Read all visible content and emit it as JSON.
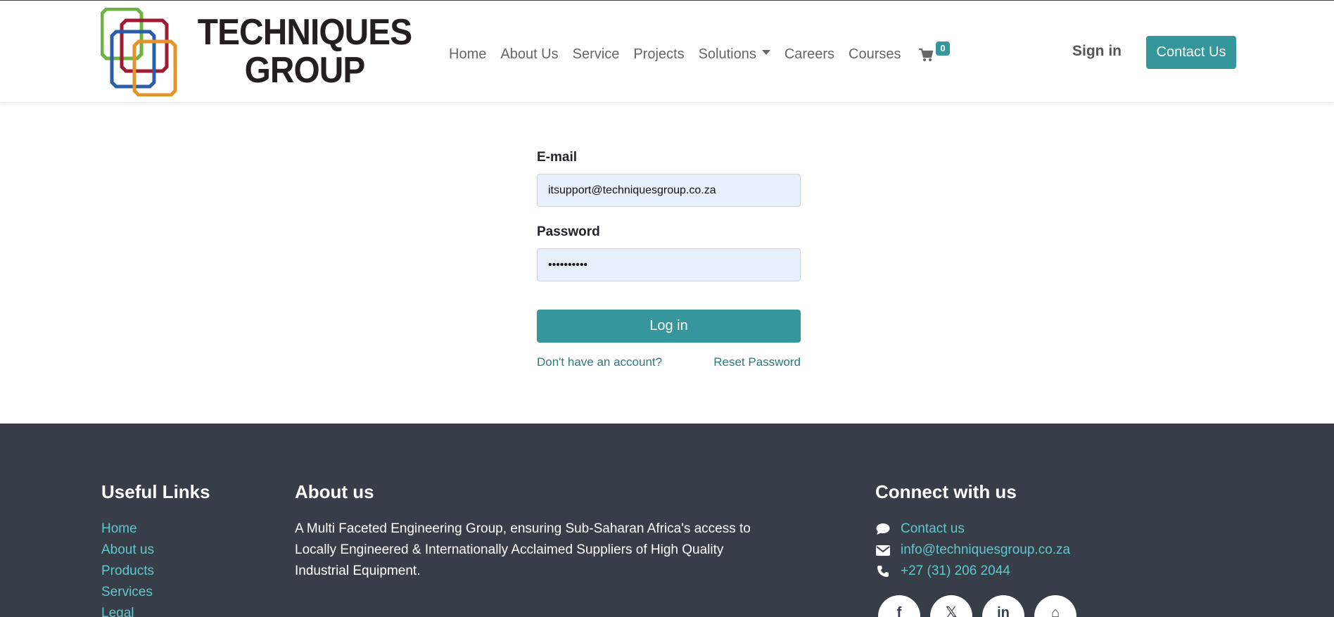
{
  "header": {
    "logo": {
      "line1": "TECHNIQUES",
      "line2": "GROUP",
      "colors": [
        "#6cb33f",
        "#9e1b32",
        "#2a5ea8",
        "#e5932b"
      ]
    },
    "nav": [
      {
        "label": "Home"
      },
      {
        "label": "About Us"
      },
      {
        "label": "Service"
      },
      {
        "label": "Projects"
      },
      {
        "label": "Solutions",
        "has_dropdown": true
      },
      {
        "label": "Careers"
      },
      {
        "label": "Courses"
      }
    ],
    "cart_count": "0",
    "sign_in": "Sign in",
    "contact_button": "Contact Us"
  },
  "login": {
    "email_label": "E-mail",
    "email_value": "itsupport@techniquesgroup.co.za",
    "password_label": "Password",
    "password_value": "••••••••••",
    "submit": "Log in",
    "signup_link": "Don't have an account?",
    "reset_link": "Reset Password"
  },
  "footer": {
    "useful_links": {
      "heading": "Useful Links",
      "items": [
        "Home",
        "About us",
        "Products",
        "Services",
        "Legal"
      ]
    },
    "about": {
      "heading": "About us",
      "text": "A Multi Faceted Engineering Group, ensuring Sub-Saharan Africa's access to Locally Engineered & Internationally Acclaimed Suppliers of High Quality Industrial Equipment."
    },
    "connect": {
      "heading": "Connect with us",
      "contact": "Contact us",
      "email": "info@techniquesgroup.co.za",
      "phone": "+27 (31) 206 2044",
      "social": [
        {
          "icon": "facebook-icon",
          "glyph": "f"
        },
        {
          "icon": "x-twitter-icon",
          "glyph": "𝕏"
        },
        {
          "icon": "linkedin-icon",
          "glyph": "in"
        },
        {
          "icon": "home-icon",
          "glyph": "⌂"
        }
      ]
    }
  },
  "colors": {
    "accent": "#35979c",
    "footer_bg": "#373e47",
    "footer_link": "#5fc8cd",
    "input_bg": "#e8f0fe"
  }
}
